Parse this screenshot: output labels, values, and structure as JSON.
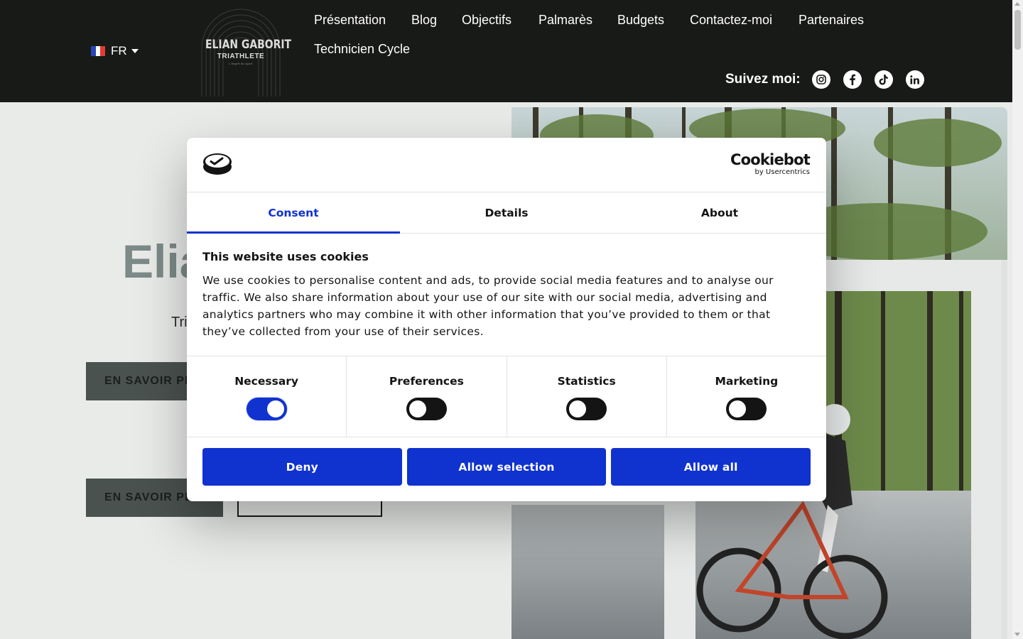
{
  "header": {
    "language": "FR",
    "logo": {
      "name": "ELIAN GABORIT",
      "subtitle": "TRIATHLETE",
      "tagline": "L'esprit du sport"
    },
    "nav": [
      "Présentation",
      "Blog",
      "Objectifs",
      "Palmarès",
      "Budgets",
      "Contactez-moi",
      "Partenaires",
      "Technicien Cycle"
    ],
    "follow_label": "Suivez moi:",
    "social": [
      "instagram-icon",
      "facebook-icon",
      "tiktok-icon",
      "linkedin-icon"
    ]
  },
  "hero": {
    "title": "Elia",
    "subtitle": "Tri",
    "button_1": "EN SAVOIR PL",
    "button_2": "EN SAVOIR PL"
  },
  "cookie_dialog": {
    "brand": "Cookiebot",
    "brand_by": "by Usercentrics",
    "tabs": [
      {
        "label": "Consent",
        "active": true
      },
      {
        "label": "Details",
        "active": false
      },
      {
        "label": "About",
        "active": false
      }
    ],
    "title": "This website uses cookies",
    "text": "We use cookies to personalise content and ads, to provide social media features and to analyse our traffic. We also share information about your use of our site with our social media, advertising and analytics partners who may combine it with other information that you’ve provided to them or that they’ve collected from your use of their services.",
    "categories": [
      {
        "label": "Necessary",
        "enabled": true
      },
      {
        "label": "Preferences",
        "enabled": false
      },
      {
        "label": "Statistics",
        "enabled": false
      },
      {
        "label": "Marketing",
        "enabled": false
      }
    ],
    "buttons": {
      "deny": "Deny",
      "allow_selection": "Allow selection",
      "allow_all": "Allow all"
    },
    "accent_color": "#1032cf"
  }
}
